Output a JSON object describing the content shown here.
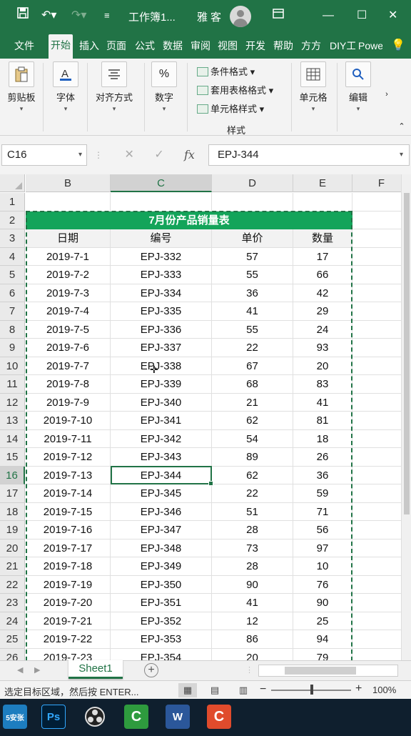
{
  "title_bar": {
    "save_icon": "save-icon",
    "undo_icon": "undo-icon",
    "redo_icon": "redo-icon",
    "document_title": "工作簿1...",
    "user_name": "雅客",
    "ribbon_display_icon": "ribbon-display-icon",
    "minimize": "—",
    "maximize": "☐",
    "close": "✕"
  },
  "tabs": [
    {
      "label": "文件",
      "active": false
    },
    {
      "label": "开始",
      "active": true
    },
    {
      "label": "插入",
      "active": false
    },
    {
      "label": "页面",
      "active": false
    },
    {
      "label": "公式",
      "active": false
    },
    {
      "label": "数据",
      "active": false
    },
    {
      "label": "审阅",
      "active": false
    },
    {
      "label": "视图",
      "active": false
    },
    {
      "label": "开发",
      "active": false
    },
    {
      "label": "帮助",
      "active": false
    },
    {
      "label": "方方",
      "active": false
    },
    {
      "label": "DIY工",
      "active": false
    },
    {
      "label": "Powe",
      "active": false
    }
  ],
  "ribbon": {
    "clipboard": "剪贴板",
    "font": "字体",
    "alignment": "对齐方式",
    "number": "数字",
    "number_symbol": "%",
    "conditional_format": "条件格式",
    "table_format": "套用表格格式",
    "cell_style": "单元格样式",
    "styles_group": "样式",
    "cells": "单元格",
    "editing": "编辑"
  },
  "formula_bar": {
    "name_box": "C16",
    "fx_label": "fx",
    "formula_value": "EPJ-344"
  },
  "columns": [
    "B",
    "C",
    "D",
    "E",
    "F"
  ],
  "selected_column": "C",
  "table": {
    "title": "7月份产品销量表",
    "headers": [
      "日期",
      "编号",
      "单价",
      "数量"
    ],
    "rows": [
      [
        "2019-7-1",
        "EPJ-332",
        "57",
        "17"
      ],
      [
        "2019-7-2",
        "EPJ-333",
        "55",
        "66"
      ],
      [
        "2019-7-3",
        "EPJ-334",
        "36",
        "42"
      ],
      [
        "2019-7-4",
        "EPJ-335",
        "41",
        "29"
      ],
      [
        "2019-7-5",
        "EPJ-336",
        "55",
        "24"
      ],
      [
        "2019-7-6",
        "EPJ-337",
        "22",
        "93"
      ],
      [
        "2019-7-7",
        "EPJ-338",
        "67",
        "20"
      ],
      [
        "2019-7-8",
        "EPJ-339",
        "68",
        "83"
      ],
      [
        "2019-7-9",
        "EPJ-340",
        "21",
        "41"
      ],
      [
        "2019-7-10",
        "EPJ-341",
        "62",
        "81"
      ],
      [
        "2019-7-11",
        "EPJ-342",
        "54",
        "18"
      ],
      [
        "2019-7-12",
        "EPJ-343",
        "89",
        "26"
      ],
      [
        "2019-7-13",
        "EPJ-344",
        "62",
        "36"
      ],
      [
        "2019-7-14",
        "EPJ-345",
        "22",
        "59"
      ],
      [
        "2019-7-15",
        "EPJ-346",
        "51",
        "71"
      ],
      [
        "2019-7-16",
        "EPJ-347",
        "28",
        "56"
      ],
      [
        "2019-7-17",
        "EPJ-348",
        "73",
        "97"
      ],
      [
        "2019-7-18",
        "EPJ-349",
        "28",
        "10"
      ],
      [
        "2019-7-19",
        "EPJ-350",
        "90",
        "76"
      ],
      [
        "2019-7-20",
        "EPJ-351",
        "41",
        "90"
      ],
      [
        "2019-7-21",
        "EPJ-352",
        "12",
        "25"
      ],
      [
        "2019-7-22",
        "EPJ-353",
        "86",
        "94"
      ],
      [
        "2019-7-23",
        "EPJ-354",
        "20",
        "79"
      ]
    ]
  },
  "sheet_tab": "Sheet1",
  "add_sheet": "+",
  "status_bar": {
    "message": "选定目标区域，然后按 ENTER...",
    "zoom_minus": "−",
    "zoom_plus": "+",
    "zoom_level": "100%"
  },
  "taskbar": {
    "apps": [
      "start-icon",
      "photoshop-icon",
      "obs-icon",
      "camtasia-icon",
      "word-icon",
      "camtasia-recorder-icon"
    ],
    "start_label": "5安张",
    "ps_label": "Ps",
    "word_label": "W",
    "c_label": "C"
  },
  "colors": {
    "excel_green": "#217346",
    "title_fill": "#13a45a",
    "selection": "#217346"
  }
}
